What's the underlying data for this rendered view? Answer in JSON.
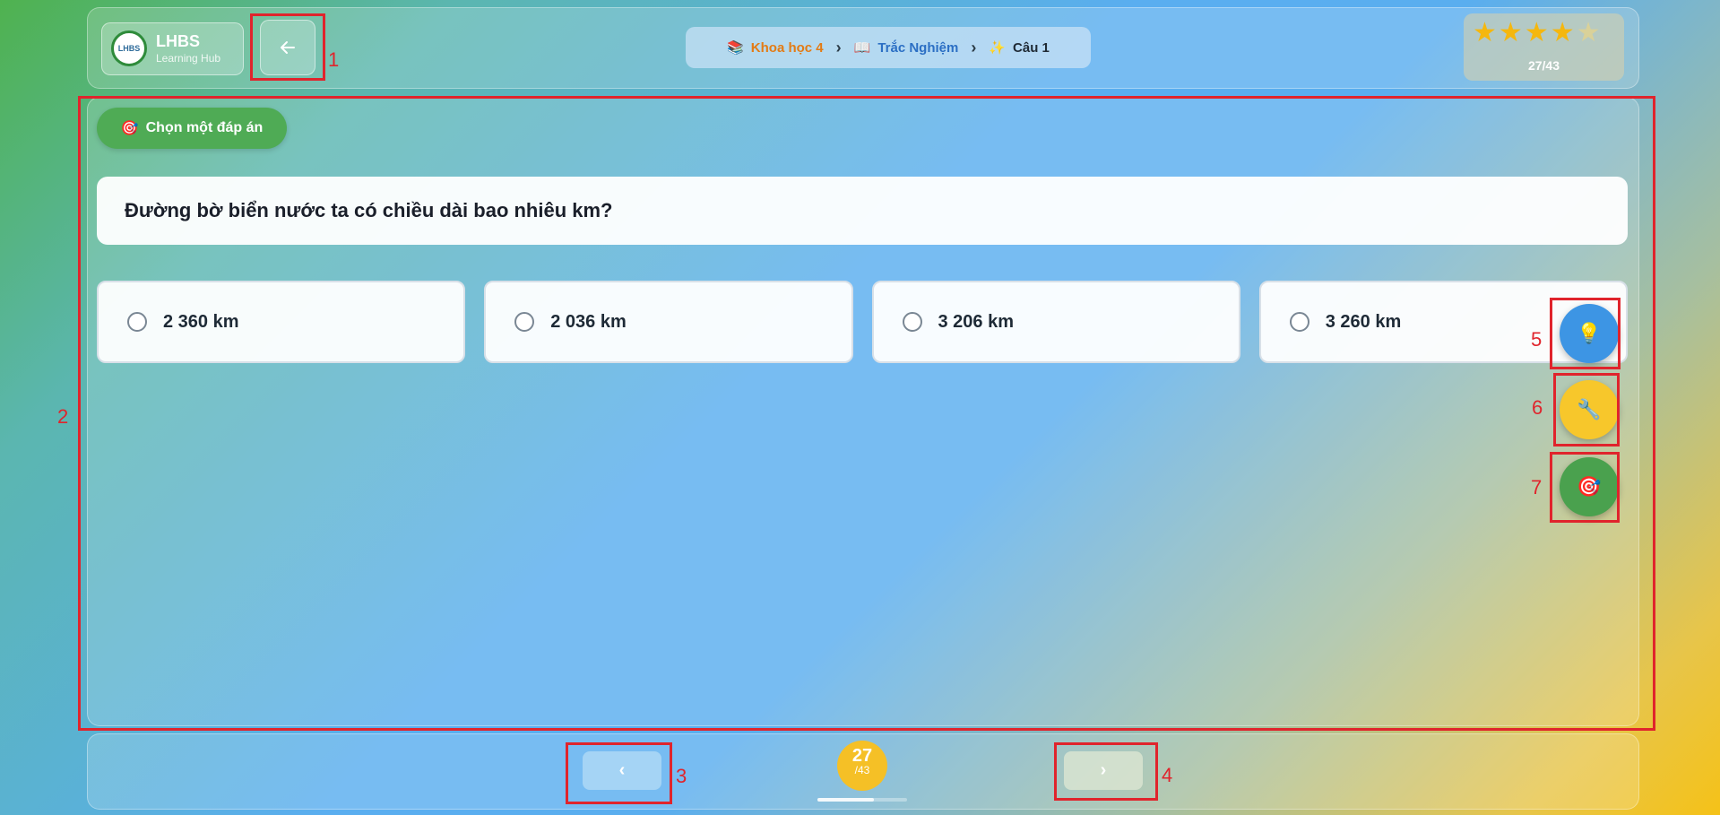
{
  "header": {
    "logo_title": "LHBS",
    "logo_subtitle": "Learning Hub",
    "logo_badge": "LHBS",
    "back_icon": "arrow-left-icon",
    "breadcrumb": [
      {
        "icon": "📚",
        "label": "Khoa học 4"
      },
      {
        "icon": "📖",
        "label": "Trắc Nghiệm"
      },
      {
        "icon": "✨",
        "label": "Câu 1"
      }
    ],
    "breadcrumb_separator": "›",
    "stars_filled": 4,
    "stars_total": 5,
    "progress_text": "27/43"
  },
  "main": {
    "instruction_icon": "🎯",
    "instruction": "Chọn một đáp án",
    "question": "Đường bờ biển nước ta có chiều dài bao nhiêu km?",
    "options": [
      "2 360 km",
      "2 036 km",
      "3 206 km",
      "3 260 km"
    ],
    "fabs": {
      "hint_icon": "💡",
      "tool_icon": "🔧",
      "target_icon": "🎯"
    }
  },
  "footer": {
    "prev_label": "‹",
    "next_label": "›",
    "current": "27",
    "total": "/43",
    "progress_fraction": 0.63
  },
  "annotations": [
    "1",
    "2",
    "3",
    "4",
    "5",
    "6",
    "7"
  ],
  "colors": {
    "annotation": "#e0242c",
    "instruction_bg": "#4fab55",
    "counter_bg": "#f5c026"
  }
}
